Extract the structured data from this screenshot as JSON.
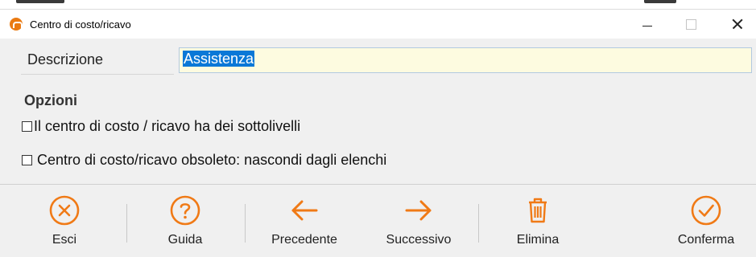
{
  "window": {
    "title": "Centro di costo/ricavo",
    "controls": [
      "minimize",
      "maximize",
      "close"
    ]
  },
  "form": {
    "description_label": "Descrizione",
    "description_value": "Assistenza",
    "options_heading": "Opzioni",
    "options": [
      {
        "label": "Il centro di costo / ricavo ha dei sottolivelli",
        "checked": false
      },
      {
        "label": "Centro di costo/ricavo obsoleto: nascondi dagli elenchi",
        "checked": false
      }
    ]
  },
  "toolbar": {
    "accent": "#f07a16",
    "buttons": [
      {
        "label": "Esci",
        "icon": "close-circle-icon"
      },
      {
        "label": "Guida",
        "icon": "help-circle-icon"
      },
      {
        "label": "Precedente",
        "icon": "arrow-left-icon"
      },
      {
        "label": "Successivo",
        "icon": "arrow-right-icon"
      },
      {
        "label": "Elimina",
        "icon": "trash-icon"
      },
      {
        "label": "Conferma",
        "icon": "check-circle-icon"
      }
    ]
  }
}
